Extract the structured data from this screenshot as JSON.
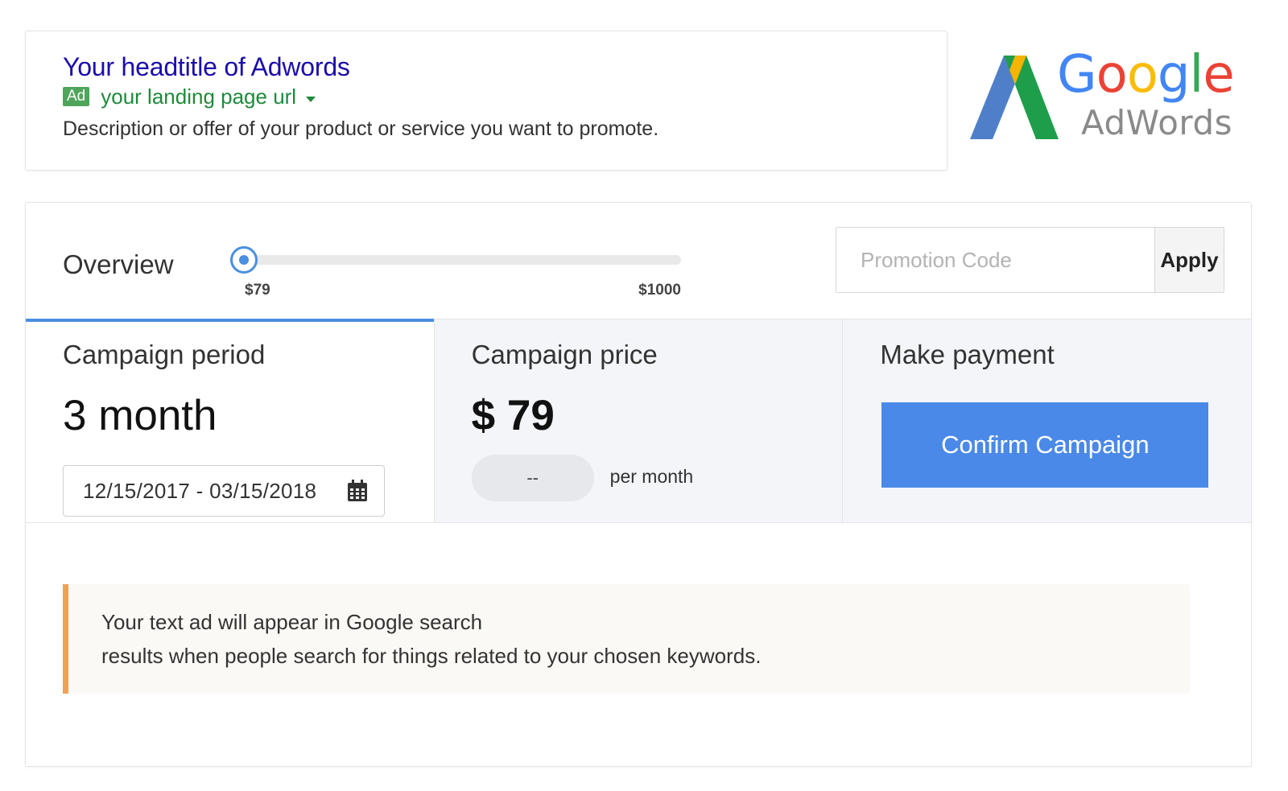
{
  "ad_preview": {
    "title": "Your headtitle of Adwords",
    "badge": "Ad",
    "url": "your landing page url",
    "description": "Description or offer of your product or service you want to promote."
  },
  "logo": {
    "word_google": [
      "G",
      "o",
      "o",
      "g",
      "l",
      "e"
    ],
    "word_google_colors": [
      "#4285f4",
      "#ea4335",
      "#fbbc05",
      "#4285f4",
      "#34a853",
      "#ea4335"
    ],
    "word_adwords": "AdWords",
    "mark_colors": {
      "left": "#4f7fc9",
      "right": "#1e9e4a",
      "inner": "#f4b400"
    }
  },
  "overview": {
    "label": "Overview",
    "slider": {
      "min_label": "$79",
      "max_label": "$1000",
      "min": 79,
      "max": 1000,
      "value": 79
    },
    "promo": {
      "placeholder": "Promotion Code",
      "value": "",
      "apply_label": "Apply"
    }
  },
  "steps": {
    "period": {
      "title": "Campaign period",
      "value": "3 month",
      "date_range": "12/15/2017 - 03/15/2018",
      "icon": "calendar-icon"
    },
    "price": {
      "title": "Campaign price",
      "value": "$ 79",
      "pill": "--",
      "per": "per month"
    },
    "payment": {
      "title": "Make payment",
      "button": "Confirm Campaign"
    }
  },
  "note": {
    "lines": [
      "Your text ad will appear in Google search",
      "results when people search for things related to your chosen keywords."
    ]
  },
  "colors": {
    "accent": "#4a89e8",
    "ad_title": "#1a0dab",
    "ad_url": "#1e8a3c",
    "note_border": "#f0a154"
  }
}
